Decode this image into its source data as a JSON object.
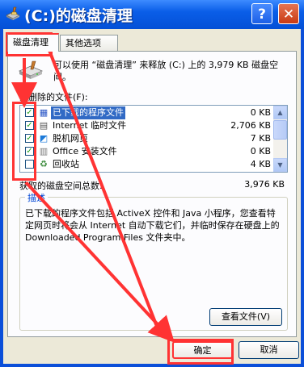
{
  "window": {
    "title": "(C:)的磁盘清理",
    "help_label": "?",
    "close_label": "✕",
    "app_icon": "disk-cleanup-icon",
    "colors": {
      "titlebar": "#0a5ee8",
      "annotation": "#ff3333",
      "selection": "#316ac5"
    }
  },
  "tabs": [
    {
      "label": "磁盘清理",
      "active": true
    },
    {
      "label": "其他选项",
      "active": false
    }
  ],
  "intro": "可以使用 “磁盘清理” 来释放 (C:) 上的 3,979 KB 磁盘空间。",
  "files_label": "要删除的文件(F):",
  "files": [
    {
      "name": "已下载的程序文件",
      "size": "0 KB",
      "checked": true,
      "icon": "downloaded-program-icon",
      "selected": true
    },
    {
      "name": "Internet 临时文件",
      "size": "2,706 KB",
      "checked": true,
      "icon": "internet-temp-icon",
      "selected": false
    },
    {
      "name": "脱机网页",
      "size": "7 KB",
      "checked": true,
      "icon": "offline-page-icon",
      "selected": false
    },
    {
      "name": "Office 安装文件",
      "size": "0 KB",
      "checked": true,
      "icon": "office-setup-icon",
      "selected": false
    },
    {
      "name": "回收站",
      "size": "4 KB",
      "checked": false,
      "icon": "recycle-bin-icon",
      "selected": false
    }
  ],
  "total_label": "获取的磁盘空间总数:",
  "total_value": "3,976 KB",
  "description": {
    "legend": "描述",
    "text": "已下载的程序文件包括 ActiveX 控件和 Java 小程序，您查看特定网页时将会从 Internet 自动下载它们，并临时保存在硬盘上的 Downloaded Program Files 文件夹中。",
    "view_button": "查看文件(V)"
  },
  "buttons": {
    "ok": "确定",
    "cancel": "取消"
  }
}
